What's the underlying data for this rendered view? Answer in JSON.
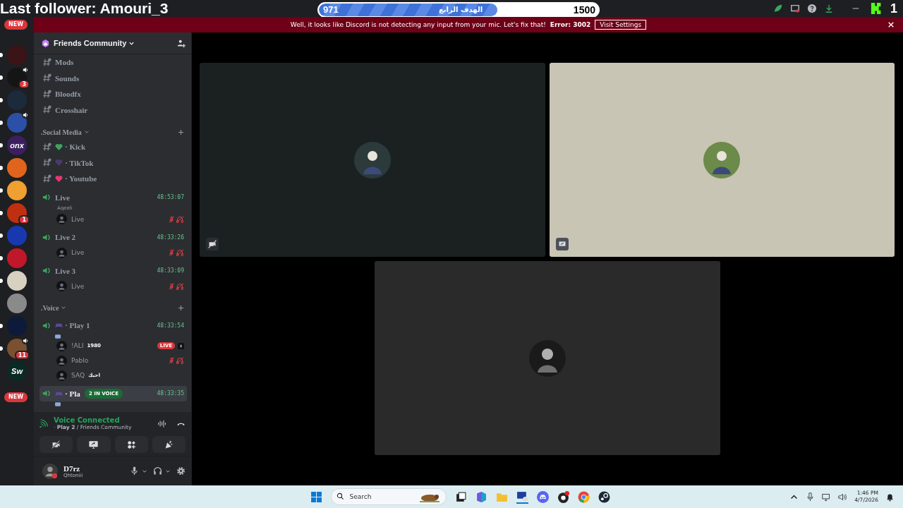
{
  "overlay": {
    "follower": "Last follower: Amouri_3",
    "goal": {
      "current": "971",
      "label": "الهدف الرابع",
      "target": "1500",
      "level": 0.64
    },
    "kick_count": "1"
  },
  "banner": {
    "message": "Well, it looks like Discord is not detecting any input from your mic. Let's fix that!",
    "error": "Error: 3002",
    "button": "Visit Settings"
  },
  "new_badges": [
    "NEW",
    "NEW"
  ],
  "servers": [
    {
      "color": "#3a1416",
      "unread": true,
      "speaker": false
    },
    {
      "color": "#151515",
      "unread": true,
      "speaker": true,
      "badge": "3"
    },
    {
      "color": "#1c2b3c",
      "unread": true,
      "speaker": false
    },
    {
      "color": "#2c4fa8",
      "unread": true,
      "speaker": true
    },
    {
      "color": "#3b1f5e",
      "unread": true,
      "speaker": false,
      "text": "onx"
    },
    {
      "color": "#e0641c",
      "unread": true,
      "speaker": false
    },
    {
      "color": "#f0a030",
      "unread": true,
      "speaker": false
    },
    {
      "color": "#c03010",
      "unread": true,
      "speaker": false,
      "badge": "1"
    },
    {
      "color": "#1838b0",
      "unread": true,
      "speaker": false
    },
    {
      "color": "#c0182a",
      "unread": true,
      "speaker": false
    },
    {
      "color": "#d8d0c0",
      "unread": true,
      "speaker": false
    },
    {
      "color": "#8a8a8a",
      "unread": false,
      "speaker": false
    },
    {
      "color": "#0d1a3a",
      "unread": true,
      "speaker": false
    },
    {
      "color": "#7a5030",
      "unread": true,
      "speaker": true,
      "badge": "11"
    },
    {
      "color": "#0a2a24",
      "unread": false,
      "speaker": false,
      "text": "Sw"
    }
  ],
  "server_header": {
    "name": "Friends Community"
  },
  "channels": [
    {
      "kind": "text",
      "name": "Mods",
      "selected": false
    },
    {
      "kind": "text",
      "name": "Sounds",
      "selected": false
    },
    {
      "kind": "text",
      "name": "Bloodfx",
      "selected": false
    },
    {
      "kind": "text",
      "name": "Crosshair",
      "selected": false
    },
    {
      "kind": "category",
      "name": ".Social Media"
    },
    {
      "kind": "text",
      "name": "· Kick",
      "color": "#3ba55d",
      "selected": false
    },
    {
      "kind": "text",
      "name": "· TikTok",
      "color": "#4b3a6e",
      "selected": false
    },
    {
      "kind": "text",
      "name": "· Youtube",
      "color": "#e8366f",
      "selected": false
    },
    {
      "kind": "voice",
      "name": "Live",
      "timer": "48:53:07",
      "status": "Aqeeli",
      "selected": false,
      "members": [
        {
          "name": "Live",
          "muted": true
        }
      ]
    },
    {
      "kind": "voice",
      "name": "Live 2",
      "timer": "48:33:26",
      "selected": false,
      "members": [
        {
          "name": "Live",
          "muted": true
        }
      ]
    },
    {
      "kind": "voice",
      "name": "Live 3",
      "timer": "48:33:09",
      "selected": false,
      "members": [
        {
          "name": "Live",
          "muted": true
        }
      ]
    },
    {
      "kind": "category",
      "name": ".Voice"
    },
    {
      "kind": "voice",
      "name": "· Play 1",
      "game": true,
      "activity": true,
      "timer": "48:33:54",
      "selected": false,
      "members": [
        {
          "name": "!ALI",
          "tag": "1980",
          "badge": "LIVE",
          "muted": false
        },
        {
          "name": "Pablo",
          "muted": true
        },
        {
          "name": "SAQ",
          "tag": "احبك",
          "muted": false
        }
      ]
    },
    {
      "kind": "voice",
      "name": "· Pla",
      "game": true,
      "activity": true,
      "timer": "48:33:35",
      "popup": "2 IN VOICE",
      "selected": true
    }
  ],
  "voice_panel": {
    "title": "Voice Connected",
    "location": "· **Play 2** / Friends Community"
  },
  "user": {
    "name": "D7rz",
    "status": "Qhtoniii"
  },
  "tiles": [
    {
      "color": "#1b2121",
      "camera_off": true,
      "screen_share": false
    },
    {
      "color": "#c9c5b5",
      "camera_off": false,
      "screen_share": true
    },
    {
      "color": "#2a2a2a",
      "camera_off": false,
      "screen_share": false
    }
  ],
  "taskbar": {
    "search_placeholder": "Search",
    "time": "1:46 PM",
    "date": "4/7/2026"
  }
}
